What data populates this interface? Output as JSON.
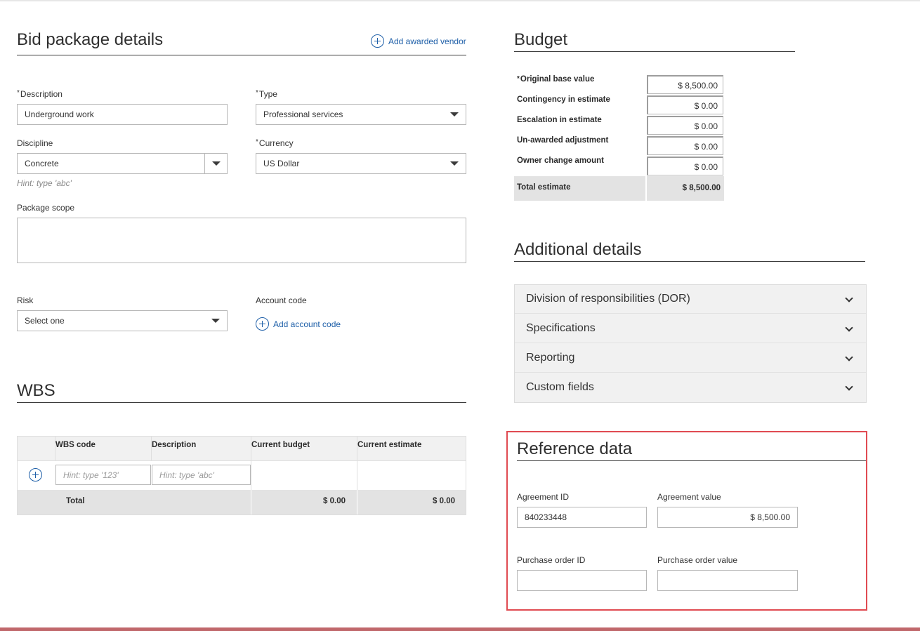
{
  "bid_package": {
    "title": "Bid package details",
    "add_vendor_label": "Add awarded vendor",
    "description_label": "Description",
    "description_value": "Underground work",
    "type_label": "Type",
    "type_value": "Professional services",
    "discipline_label": "Discipline",
    "discipline_value": "Concrete",
    "discipline_hint": "Hint: type 'abc'",
    "currency_label": "Currency",
    "currency_value": "US Dollar",
    "package_scope_label": "Package scope",
    "package_scope_value": "",
    "risk_label": "Risk",
    "risk_value": "Select one",
    "account_code_label": "Account code",
    "add_account_code_label": "Add account code",
    "required_mark": "*"
  },
  "budget": {
    "title": "Budget",
    "rows": [
      {
        "label": "Original base value",
        "value": "$ 8,500.00",
        "required": true
      },
      {
        "label": "Contingency in estimate",
        "value": "$ 0.00"
      },
      {
        "label": "Escalation in estimate",
        "value": "$ 0.00"
      },
      {
        "label": "Un-awarded adjustment",
        "value": "$ 0.00"
      },
      {
        "label": "Owner change amount",
        "value": "$ 0.00"
      }
    ],
    "total_label": "Total estimate",
    "total_value": "$ 8,500.00"
  },
  "additional_details": {
    "title": "Additional details",
    "items": [
      {
        "label": "Division of responsibilities (DOR)"
      },
      {
        "label": "Specifications"
      },
      {
        "label": "Reporting"
      },
      {
        "label": "Custom fields"
      }
    ]
  },
  "wbs": {
    "title": "WBS",
    "columns": [
      "WBS code",
      "Description",
      "Current budget",
      "Current estimate"
    ],
    "code_placeholder": "Hint: type '123'",
    "description_placeholder": "Hint: type 'abc'",
    "total_label": "Total",
    "total_budget": "$ 0.00",
    "total_estimate": "$ 0.00"
  },
  "reference_data": {
    "title": "Reference data",
    "agreement_id_label": "Agreement ID",
    "agreement_id_value": "840233448",
    "agreement_value_label": "Agreement value",
    "agreement_value_value": "$ 8,500.00",
    "po_id_label": "Purchase order ID",
    "po_id_value": "",
    "po_value_label": "Purchase order value",
    "po_value_value": ""
  },
  "colors": {
    "link": "#1e5fa8",
    "highlight_border": "#e04b52",
    "bottom_bar": "#c0676b"
  }
}
